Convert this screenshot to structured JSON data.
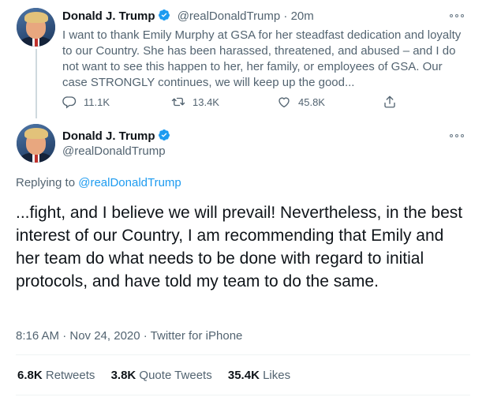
{
  "tweet1": {
    "name": "Donald J. Trump",
    "handle": "@realDonaldTrump",
    "time": "· 20m",
    "text": "I want to thank Emily Murphy at GSA for her steadfast dedication and loyalty to our Country. She has been harassed, threatened, and abused – and I do not want to see this happen to her, her family, or employees of GSA. Our case STRONGLY continues, we will keep up the good...",
    "replies": "11.1K",
    "retweets": "13.4K",
    "likes": "45.8K"
  },
  "tweet2": {
    "name": "Donald J. Trump",
    "handle": "@realDonaldTrump",
    "replying_prefix": "Replying to ",
    "replying_handle": "@realDonaldTrump",
    "text": "...fight, and I believe we will prevail! Nevertheless, in the best interest of our Country, I am recommending that Emily and her team do what needs to be done with regard to initial protocols, and have told my team to do the same.",
    "timestamp": "8:16 AM · Nov 24, 2020 · Twitter for iPhone"
  },
  "stats": {
    "retweets_count": "6.8K",
    "retweets_label": "Retweets",
    "quotes_count": "3.8K",
    "quotes_label": "Quote Tweets",
    "likes_count": "35.4K",
    "likes_label": "Likes"
  },
  "icons": {
    "verified": "verified-badge-icon",
    "more": "more-options-icon",
    "reply": "reply-icon",
    "retweet": "retweet-icon",
    "like": "heart-icon",
    "share": "share-icon"
  },
  "colors": {
    "accent": "#1d9bf0",
    "text": "#0f1419",
    "muted": "#536471"
  }
}
